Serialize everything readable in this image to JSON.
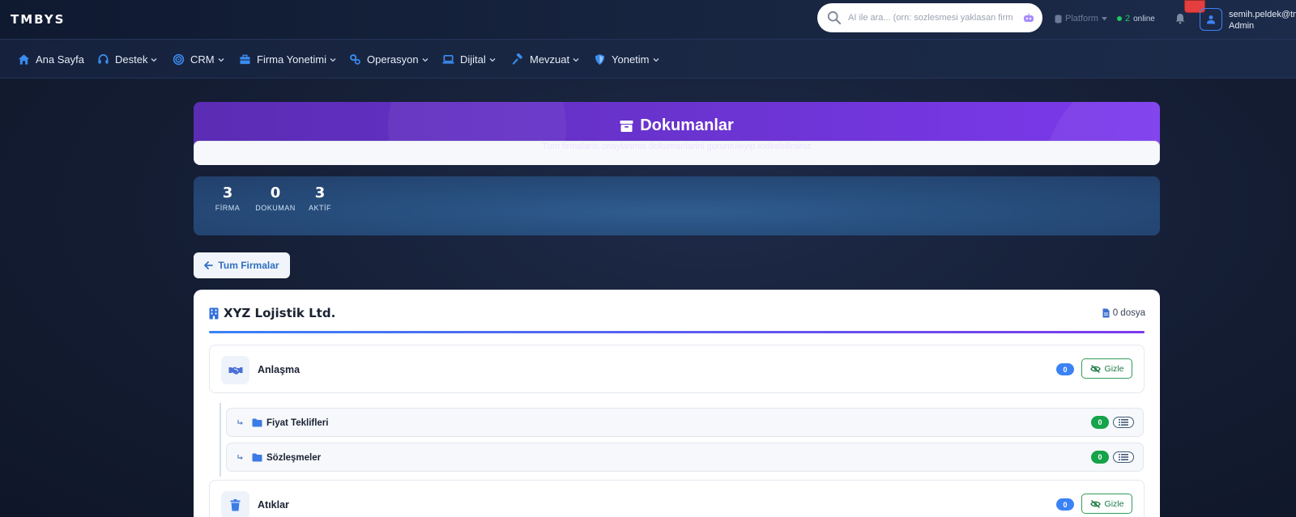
{
  "brand": "TMBYS",
  "search": {
    "placeholder": "AI ile ara... (orn: sozlesmesi yaklasan firm"
  },
  "topbar": {
    "platform_label": "Platform",
    "online_count": "2",
    "online_label": "online",
    "user_email": "semih.peldek@tm",
    "user_role": "Admin"
  },
  "nav": [
    {
      "label": "Ana Sayfa",
      "icon": "home-icon"
    },
    {
      "label": "Destek",
      "icon": "headset-icon"
    },
    {
      "label": "CRM",
      "icon": "target-icon"
    },
    {
      "label": "Firma Yonetimi",
      "icon": "briefcase-icon"
    },
    {
      "label": "Operasyon",
      "icon": "gears-icon"
    },
    {
      "label": "Dijital",
      "icon": "laptop-icon"
    },
    {
      "label": "Mevzuat",
      "icon": "gavel-icon"
    },
    {
      "label": "Yonetim",
      "icon": "shield-icon"
    }
  ],
  "banner": {
    "title": "Dokumanlar",
    "subtitle": "Tum firmalarin onaylanmis dokumanlarini goruntuleyip indirebilirsiniz"
  },
  "stats": [
    {
      "value": "3",
      "label": "FİRMA"
    },
    {
      "value": "0",
      "label": "DOKUMAN"
    },
    {
      "value": "3",
      "label": "AKTİF"
    }
  ],
  "back_button": "Tum Firmalar",
  "company": {
    "name": "XYZ Lojistik Ltd.",
    "file_count": "0 dosya"
  },
  "folders": [
    {
      "name": "Anlaşma",
      "count": "0",
      "hide_label": "Gizle",
      "subfolders": [
        {
          "name": "Fiyat Teklifleri",
          "count": "0"
        },
        {
          "name": "Sözleşmeler",
          "count": "0"
        }
      ]
    },
    {
      "name": "Atıklar",
      "count": "0",
      "hide_label": "Gizle"
    }
  ],
  "colors": {
    "accent_blue": "#3b82f6",
    "accent_purple": "#7c3aed",
    "success_green": "#16a34a"
  }
}
